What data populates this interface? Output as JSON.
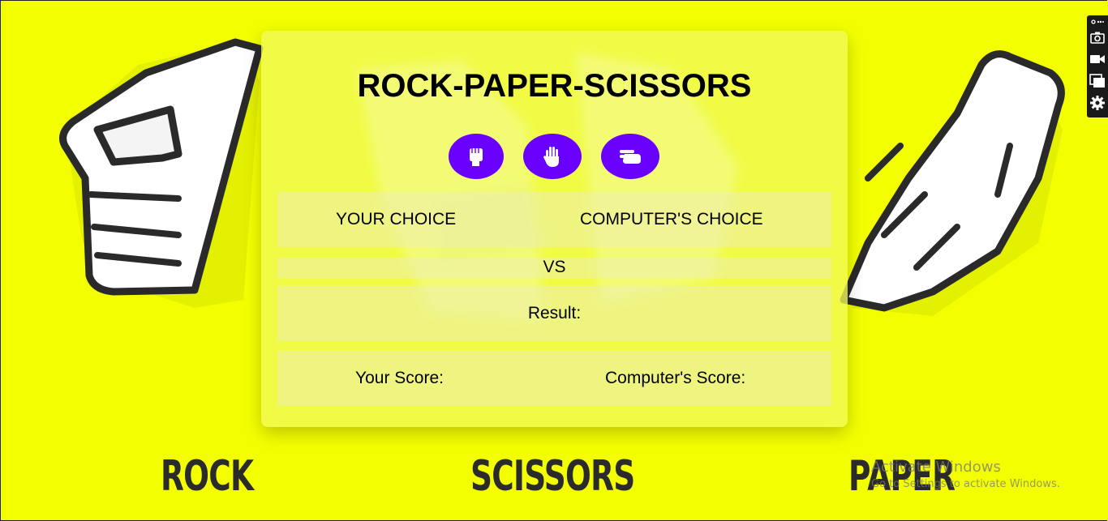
{
  "game": {
    "title": "ROCK-PAPER-SCISSORS",
    "buttons": [
      {
        "name": "rock",
        "icon": "fist-icon"
      },
      {
        "name": "paper",
        "icon": "open-hand-icon"
      },
      {
        "name": "scissors",
        "icon": "scissors-hand-icon"
      }
    ],
    "your_choice_label": "YOUR CHOICE",
    "computer_choice_label": "COMPUTER'S CHOICE",
    "vs_label": "VS",
    "result_label": "Result:",
    "your_score_label": "Your Score:",
    "computer_score_label": "Computer's Score:",
    "accent_color": "#6a00ff"
  },
  "background": {
    "color": "#f3ff00",
    "words": [
      "ROCK",
      "SCISSORS",
      "PAPER"
    ]
  },
  "toolbar": {
    "items": [
      "link-icon",
      "camera-icon",
      "video-icon",
      "window-icon",
      "gear-icon"
    ]
  },
  "watermark": {
    "line1": "Activate Windows",
    "line2": "Go to Settings to activate Windows."
  }
}
